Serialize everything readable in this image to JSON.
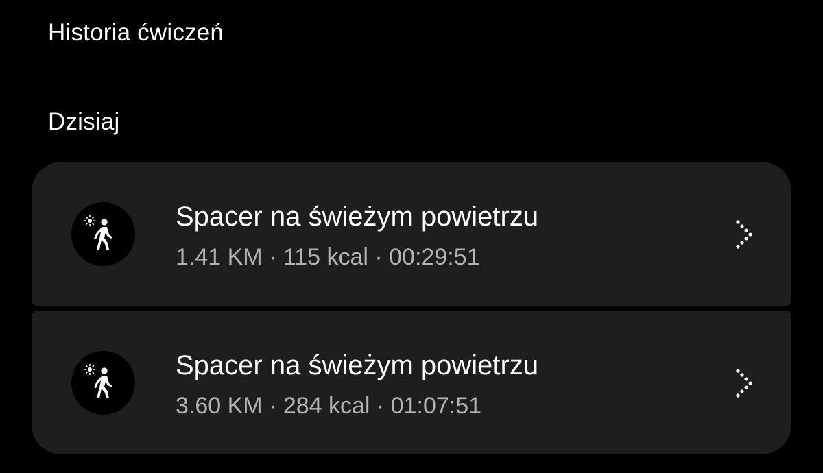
{
  "header": {
    "title": "Historia ćwiczeń"
  },
  "section": {
    "label": "Dzisiaj"
  },
  "workouts": [
    {
      "title": "Spacer na świeżym powietrzu",
      "stats": "1.41 KM · 115 kcal · 00:29:51",
      "icon": "outdoor-walk-icon"
    },
    {
      "title": "Spacer na świeżym powietrzu",
      "stats": "3.60 KM · 284 kcal · 01:07:51",
      "icon": "outdoor-walk-icon"
    }
  ],
  "colors": {
    "background": "#000000",
    "card": "#1e1e1e",
    "text_primary": "#ffffff",
    "text_secondary": "#b3b3b3"
  }
}
